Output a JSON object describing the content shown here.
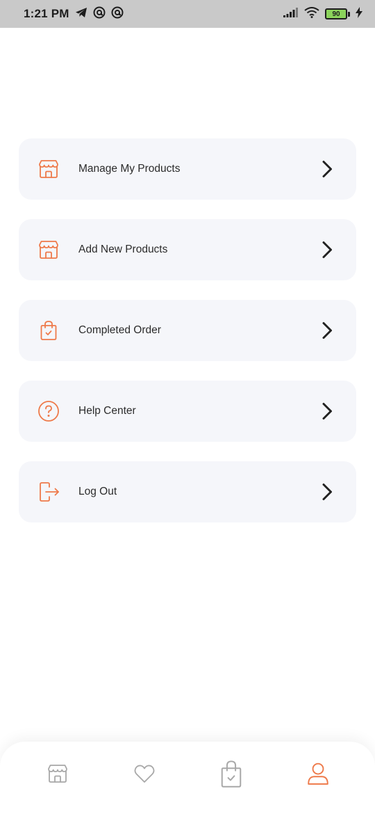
{
  "status_bar": {
    "time": "1:21 PM",
    "battery_level": "90",
    "icons": [
      "telegram-icon",
      "at-sign-icon",
      "at-sign-icon",
      "signal-icon",
      "wifi-icon",
      "battery-icon",
      "charging-icon"
    ]
  },
  "menu": {
    "items": [
      {
        "label": "Manage My Products",
        "icon": "store-icon"
      },
      {
        "label": "Add New Products",
        "icon": "store-icon"
      },
      {
        "label": "Completed Order",
        "icon": "shopping-bag-check-icon"
      },
      {
        "label": "Help Center",
        "icon": "help-circle-icon"
      },
      {
        "label": "Log Out",
        "icon": "logout-icon"
      }
    ]
  },
  "bottom_nav": {
    "items": [
      {
        "icon": "store-icon",
        "active": false
      },
      {
        "icon": "heart-icon",
        "active": false
      },
      {
        "icon": "shopping-bag-check-icon",
        "active": false
      },
      {
        "icon": "user-icon",
        "active": true
      }
    ]
  },
  "colors": {
    "accent": "#ee7a4a",
    "item_background": "#f5f6fa",
    "text": "#2b2b2b",
    "chevron": "#222222",
    "nav_inactive": "#a8a8a8",
    "status_bar": "#c9c9c9"
  }
}
